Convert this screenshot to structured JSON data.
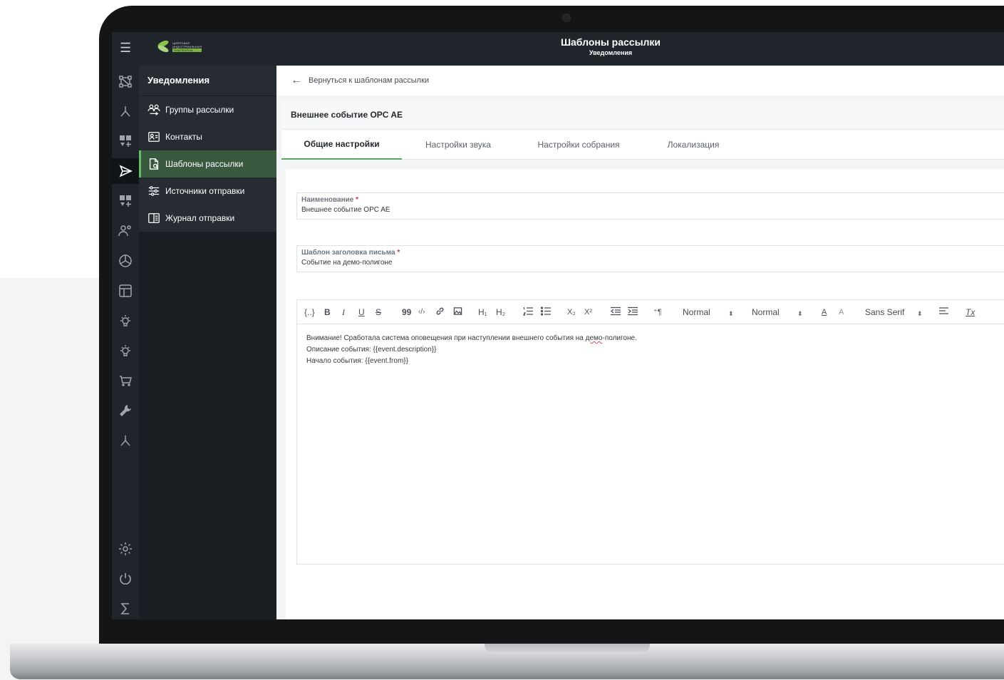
{
  "header": {
    "title": "Шаблоны рассылки",
    "subtitle": "Уведомления",
    "logo_lines": [
      "ЦИФРОВАЯ",
      "ИНДУСТРИАЛЬНАЯ",
      "ПЛАТФОРМА"
    ]
  },
  "sidebar": {
    "title": "Уведомления",
    "items": [
      {
        "label": "Группы рассылки",
        "icon": "users-icon"
      },
      {
        "label": "Контакты",
        "icon": "contact-card-icon"
      },
      {
        "label": "Шаблоны рассылки",
        "icon": "template-icon",
        "active": true
      },
      {
        "label": "Источники отправки",
        "icon": "sliders-icon"
      },
      {
        "label": "Журнал отправки",
        "icon": "book-icon"
      }
    ]
  },
  "rail": {
    "icons": [
      "graph-icon",
      "branch-icon",
      "dashboard-add-icon",
      "send-icon",
      "dashboard-add-icon",
      "user-settings-icon",
      "chart-pie-icon",
      "layout-icon",
      "bulb-icon",
      "bulb-icon",
      "cart-icon",
      "wrench-icon",
      "branch-icon",
      "gear-icon",
      "power-icon",
      "sigma-icon"
    ],
    "active_index": 3
  },
  "back": {
    "label": "Вернуться к шаблонам рассылки"
  },
  "card": {
    "title": "Внешнее событие OPC AE"
  },
  "tabs": [
    "Общие настройки",
    "Настройки звука",
    "Настройки собрания",
    "Локализация"
  ],
  "fields": {
    "name": {
      "label": "Наименование",
      "required": "*",
      "value": "Внешнее событие OPC AE"
    },
    "subject": {
      "label": "Шаблон заголовка письма",
      "required": "*",
      "value": "Событие на демо-полигоне"
    }
  },
  "toolbar": {
    "template_vars": "{..}",
    "bold": "B",
    "italic": "I",
    "underline": "U",
    "strike": "S",
    "quote": "99",
    "code": "‹/›",
    "h1": "H₁",
    "h2": "H₂",
    "sub": "X₂",
    "sup": "X²",
    "size1": "Normal",
    "size2": "Normal",
    "font": "Sans Serif",
    "clean": "Tx"
  },
  "editor": {
    "line1_a": "Внимание! Сработала система оповещения при наступлении внешнего события на ",
    "line1_b": "демо",
    "line1_c": "-полигоне.",
    "line2": "Описание события: {{event.description}}",
    "line3": "Начало события: {{event.from}}"
  }
}
